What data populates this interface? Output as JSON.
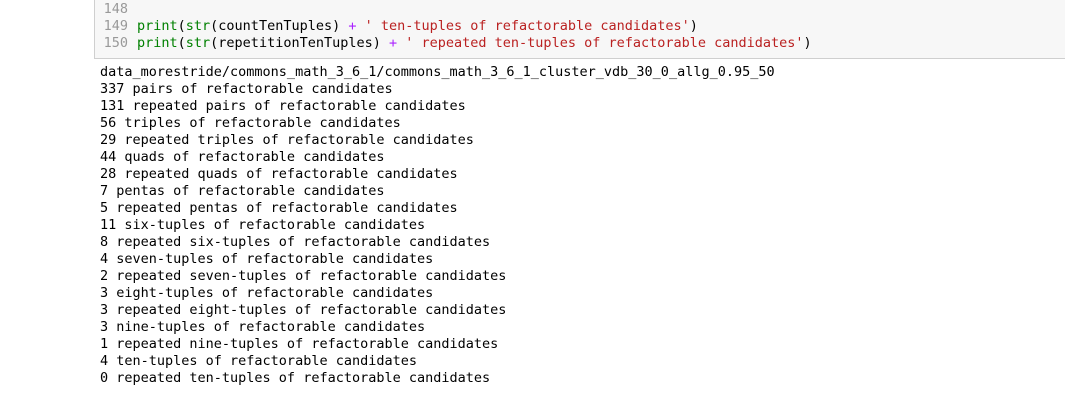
{
  "code_cell": {
    "lines": [
      {
        "number": "148",
        "tokens": []
      },
      {
        "number": "149",
        "tokens": [
          {
            "t": "builtin",
            "v": "print"
          },
          {
            "t": "plain",
            "v": "("
          },
          {
            "t": "builtin",
            "v": "str"
          },
          {
            "t": "plain",
            "v": "(countTenTuples) "
          },
          {
            "t": "op",
            "v": "+"
          },
          {
            "t": "plain",
            "v": " "
          },
          {
            "t": "string",
            "v": "' ten-tuples of refactorable candidates'"
          },
          {
            "t": "plain",
            "v": ")"
          }
        ]
      },
      {
        "number": "150",
        "tokens": [
          {
            "t": "builtin",
            "v": "print"
          },
          {
            "t": "plain",
            "v": "("
          },
          {
            "t": "builtin",
            "v": "str"
          },
          {
            "t": "plain",
            "v": "(repetitionTenTuples) "
          },
          {
            "t": "op",
            "v": "+"
          },
          {
            "t": "plain",
            "v": " "
          },
          {
            "t": "string",
            "v": "' repeated ten-tuples of refactorable candidates'"
          },
          {
            "t": "plain",
            "v": ")"
          }
        ]
      }
    ]
  },
  "output": {
    "lines": [
      "data_morestride/commons_math_3_6_1/commons_math_3_6_1_cluster_vdb_30_0_allg_0.95_50",
      "337 pairs of refactorable candidates",
      "131 repeated pairs of refactorable candidates",
      "56 triples of refactorable candidates",
      "29 repeated triples of refactorable candidates",
      "44 quads of refactorable candidates",
      "28 repeated quads of refactorable candidates",
      "7 pentas of refactorable candidates",
      "5 repeated pentas of refactorable candidates",
      "11 six-tuples of refactorable candidates",
      "8 repeated six-tuples of refactorable candidates",
      "4 seven-tuples of refactorable candidates",
      "2 repeated seven-tuples of refactorable candidates",
      "3 eight-tuples of refactorable candidates",
      "3 repeated eight-tuples of refactorable candidates",
      "3 nine-tuples of refactorable candidates",
      "1 repeated nine-tuples of refactorable candidates",
      "4 ten-tuples of refactorable candidates",
      "0 repeated ten-tuples of refactorable candidates"
    ]
  }
}
